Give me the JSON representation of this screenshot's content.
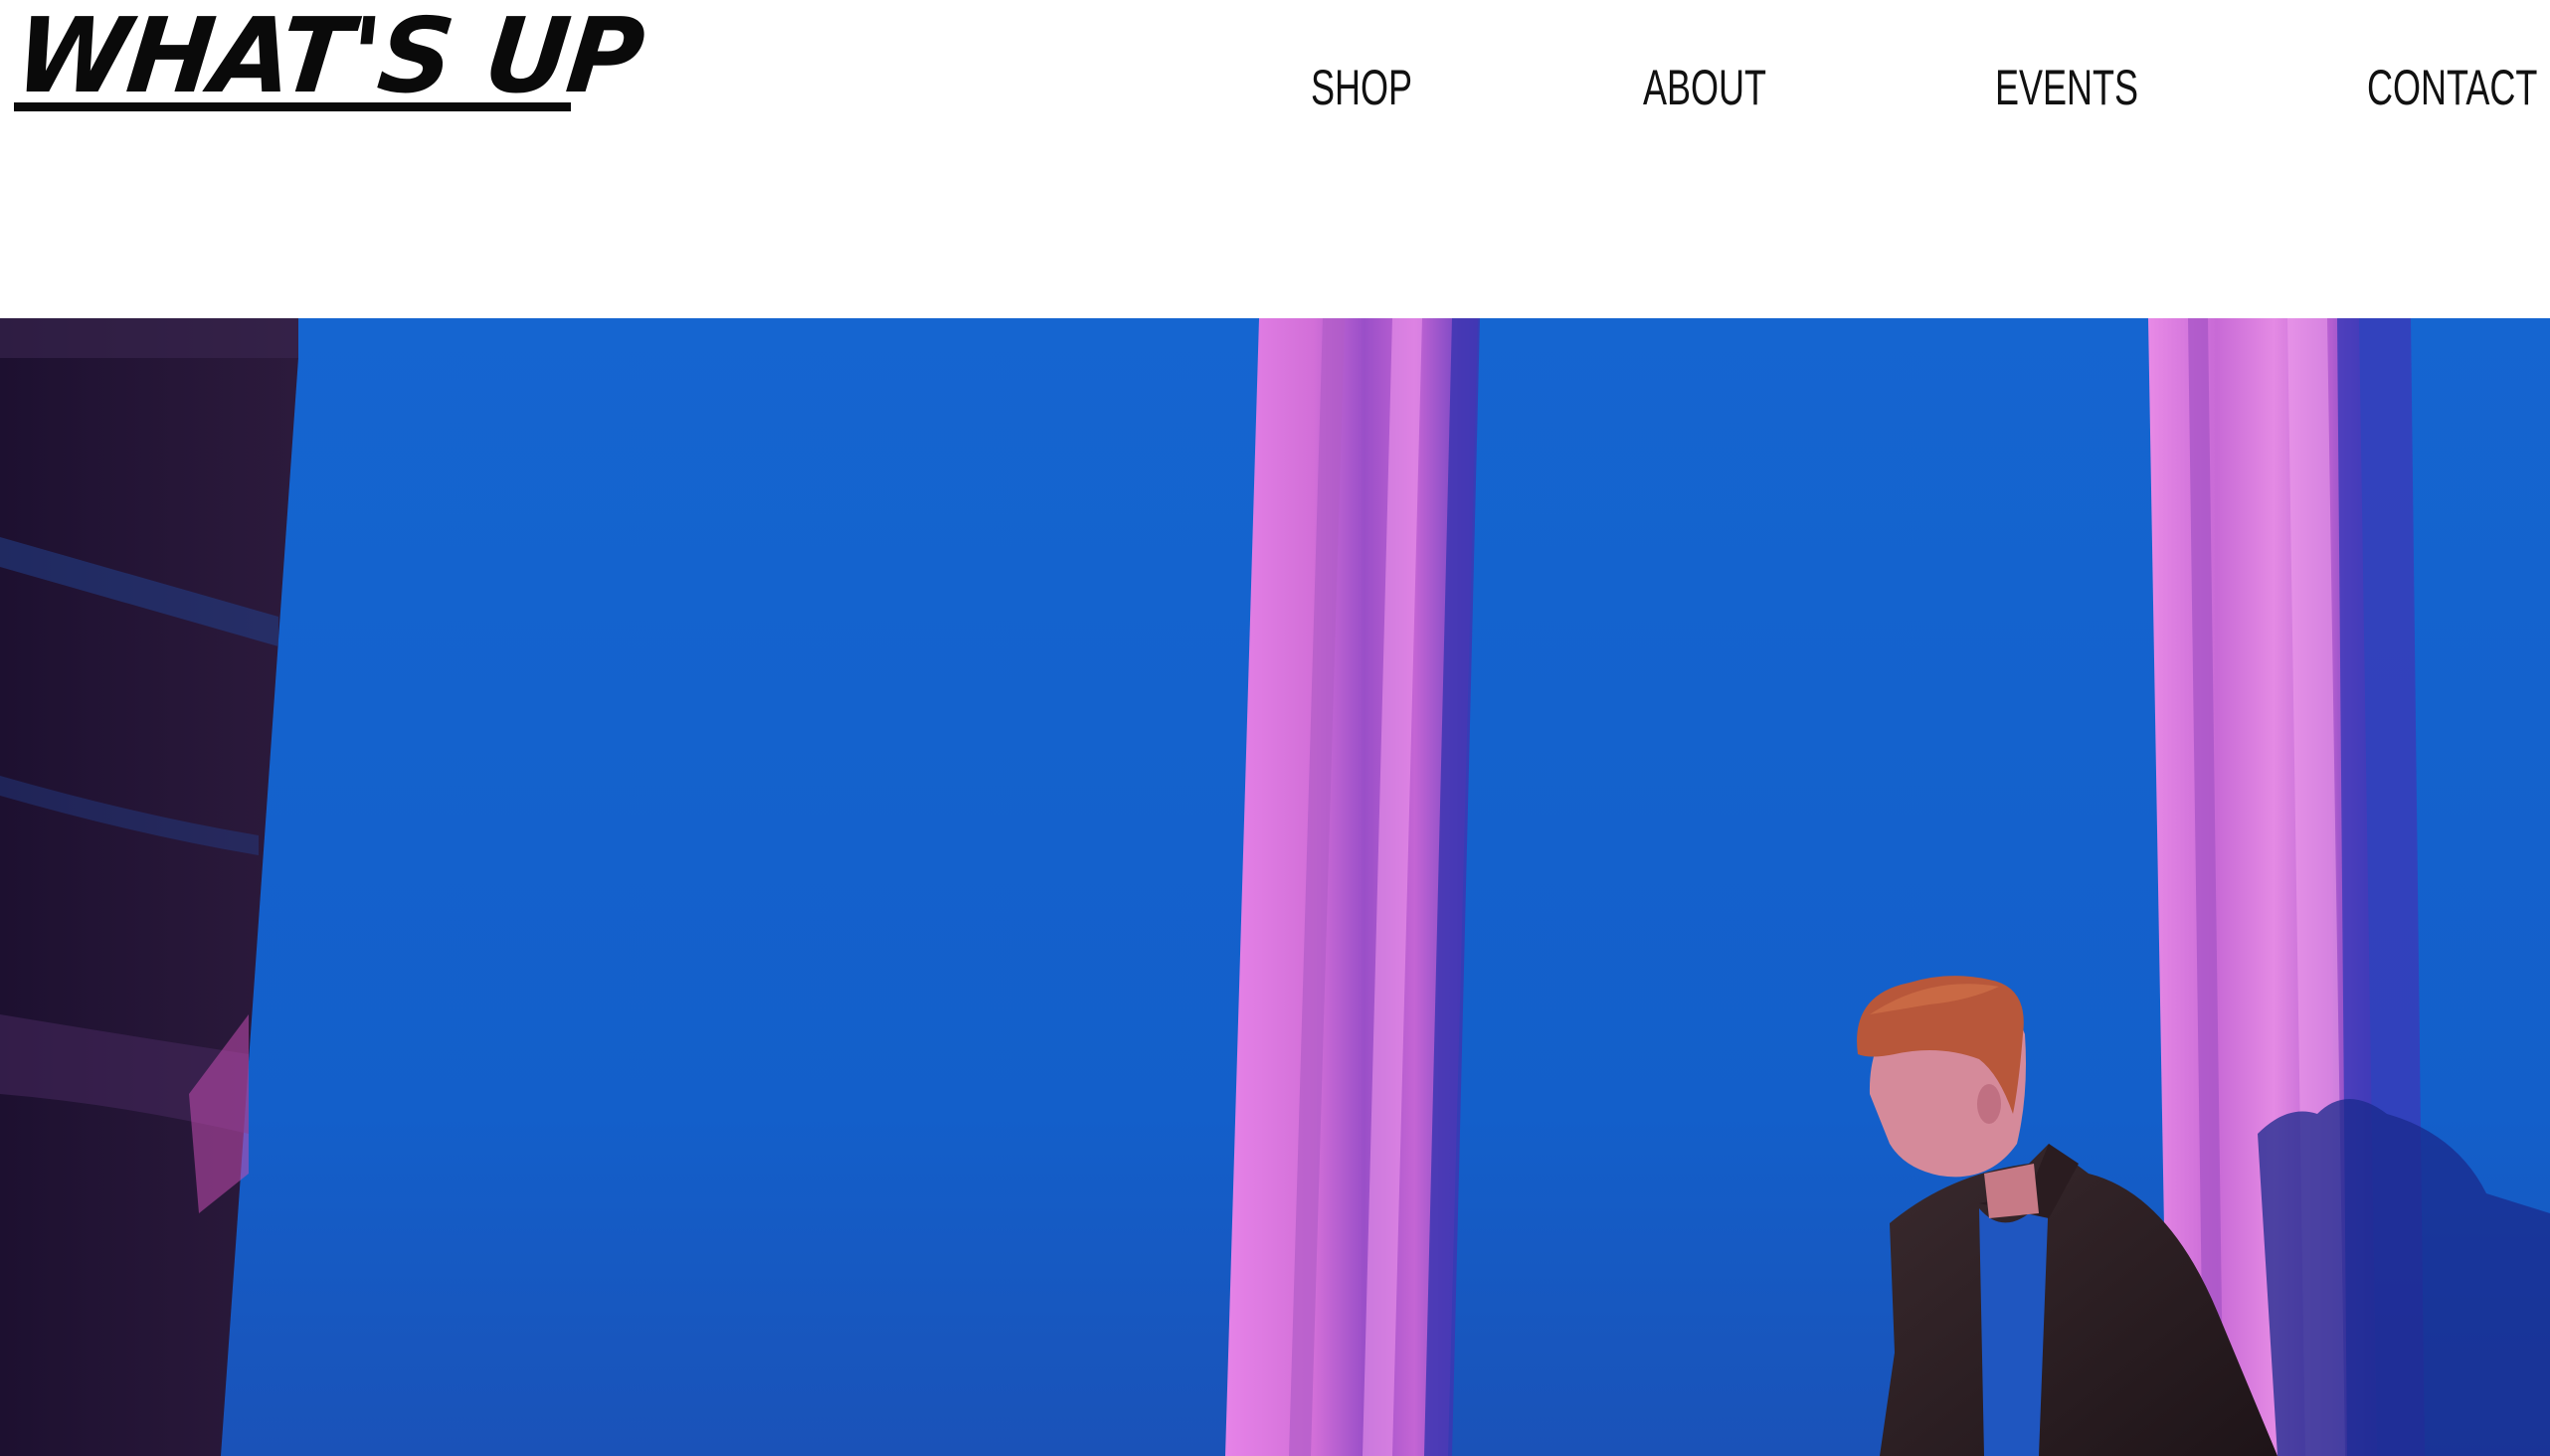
{
  "site": {
    "logo_text": "WHAT'S UP"
  },
  "nav": {
    "items": [
      {
        "label": "SHOP"
      },
      {
        "label": "ABOUT"
      },
      {
        "label": "EVENTS"
      },
      {
        "label": "CONTACT"
      }
    ]
  },
  "hero": {
    "image": "photo-person-blue-wall-pink-pillars",
    "colors": {
      "wall": "#1460cc",
      "pillar": "#e87ee8",
      "shadow_left": "#2a1630",
      "jacket": "#2b1f23",
      "hair": "#c0623a"
    }
  }
}
